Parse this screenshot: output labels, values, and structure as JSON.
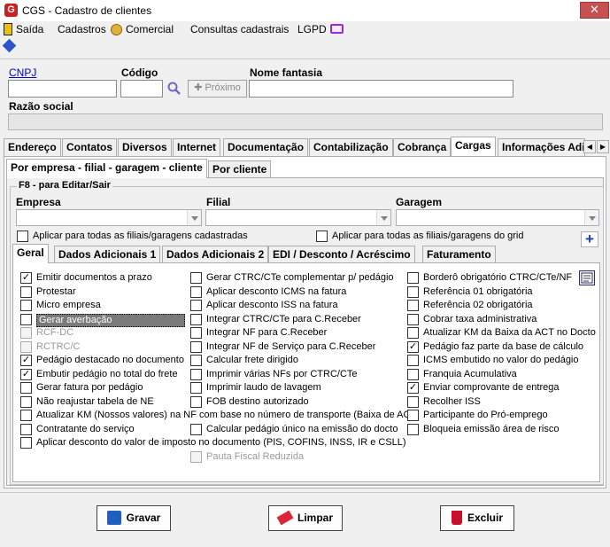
{
  "window": {
    "title": "CGS - Cadastro de clientes",
    "close_glyph": "✕"
  },
  "menu": [
    {
      "label": "Saída",
      "icon": "exit-door-icon"
    },
    {
      "label": "Cadastros"
    },
    {
      "label": "Comercial",
      "icon": "coins-icon"
    },
    {
      "label": "Consultas cadastrais"
    },
    {
      "label": "LGPD",
      "icon": "monitor-icon"
    }
  ],
  "header": {
    "cnpj_label": "CNPJ",
    "codigo_label": "Código",
    "nome_fantasia_label": "Nome fantasia",
    "razao_social_label": "Razão social",
    "proximo_label": "Próximo",
    "cnpj_value": "",
    "codigo_value": "",
    "nome_fantasia_value": ""
  },
  "main_tabs": [
    "Endereço",
    "Contatos",
    "Diversos",
    "Internet",
    "Documentação",
    "Contabilização",
    "Cobrança",
    "Cargas",
    "Informações Adi"
  ],
  "main_tab_selected": "Cargas",
  "sub_tabs": [
    "Por empresa - filial - garagem - cliente",
    "Por cliente"
  ],
  "group": {
    "title": "F8 - para Editar/Sair",
    "empresa_label": "Empresa",
    "filial_label": "Filial",
    "garagem_label": "Garagem",
    "apply_all_label": "Aplicar para todas as filiais/garagens cadastradas",
    "apply_grid_label": "Aplicar para todas as filiais/garagens do grid"
  },
  "inner_tabs": [
    "Geral",
    "Dados Adicionais 1",
    "Dados Adicionais 2",
    "EDI / Desconto / Acréscimo",
    "Faturamento"
  ],
  "checks": {
    "col1": [
      {
        "label": "Emitir documentos a prazo",
        "checked": true
      },
      {
        "label": "Protestar",
        "checked": false
      },
      {
        "label": "Micro empresa",
        "checked": false
      },
      {
        "label": "Gerar averbação",
        "checked": false
      },
      {
        "label": "RCF-DC",
        "checked": false,
        "disabled": true
      },
      {
        "label": "RCTRC/C",
        "checked": false,
        "disabled": true
      },
      {
        "label": "Pedágio destacado no documento",
        "checked": true
      },
      {
        "label": "Embutir pedágio no total do frete",
        "checked": true
      },
      {
        "label": "Gerar fatura por pedágio",
        "checked": false
      },
      {
        "label": "Não reajustar tabela de NE",
        "checked": false
      },
      {
        "label": "Atualizar KM (Nossos valores) na NF com base no número de transporte (Baixa de ACT)",
        "checked": false
      },
      {
        "label": "Contratante do serviço",
        "checked": false
      },
      {
        "label": "Aplicar desconto do valor de imposto no documento (PIS, COFINS, INSS, IR e CSLL)",
        "checked": false
      }
    ],
    "col2": [
      {
        "label": "Gerar CTRC/CTe complementar p/ pedágio",
        "checked": false
      },
      {
        "label": "Aplicar desconto ICMS na fatura",
        "checked": false
      },
      {
        "label": "Aplicar desconto ISS na fatura",
        "checked": false
      },
      {
        "label": "Integrar CTRC/CTe para C.Receber",
        "checked": false
      },
      {
        "label": "Integrar NF para C.Receber",
        "checked": false
      },
      {
        "label": "Integrar NF de Serviço para C.Receber",
        "checked": false
      },
      {
        "label": "Calcular frete dirigido",
        "checked": false
      },
      {
        "label": "Imprimir várias NFs por CTRC/CTe",
        "checked": false
      },
      {
        "label": "Imprimir laudo de lavagem",
        "checked": false
      },
      {
        "label": "FOB destino autorizado",
        "checked": false
      },
      {
        "label": "Calcular pedágio único na emissão do docto",
        "checked": false
      },
      {
        "label": "Pauta Fiscal Reduzida",
        "checked": false,
        "disabled": true
      }
    ],
    "col3": [
      {
        "label": "Borderô obrigatório  CTRC/CTe/NF",
        "checked": false
      },
      {
        "label": "Referência 01 obrigatória",
        "checked": false
      },
      {
        "label": "Referência 02 obrigatória",
        "checked": false
      },
      {
        "label": "Cobrar taxa administrativa",
        "checked": false
      },
      {
        "label": "Atualizar KM da Baixa da ACT no Docto",
        "checked": false
      },
      {
        "label": "Pedágio faz parte da base de cálculo",
        "checked": true
      },
      {
        "label": "ICMS embutido no valor do pedágio",
        "checked": false
      },
      {
        "label": "Franquia Acumulativa",
        "checked": false
      },
      {
        "label": "Enviar comprovante de entrega",
        "checked": true
      },
      {
        "label": "Recolher ISS",
        "checked": false
      },
      {
        "label": "Participante do Pró-emprego",
        "checked": false
      },
      {
        "label": "Bloqueia emissão área de risco",
        "checked": false
      }
    ]
  },
  "footer": {
    "save": "Gravar",
    "clear": "Limpar",
    "delete": "Excluir"
  },
  "colors": {
    "accent": "#0000cc",
    "danger": "#cc1f1f",
    "save_icon": "#1f5fbf"
  }
}
